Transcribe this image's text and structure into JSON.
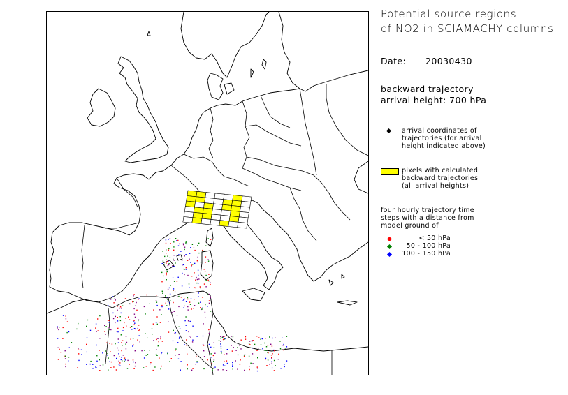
{
  "title_line1": "Potential source regions",
  "title_line2": "of NO2 in SCIAMACHY columns",
  "date_label": "Date:",
  "date_value": "20030430",
  "traj_line1": "backward trajectory",
  "traj_line2": "arrival height: 700 hPa",
  "legend": {
    "arrival": {
      "lines": [
        "arrival coordinates of",
        "trajectories (for arrival",
        "height indicated above)"
      ],
      "color": "#000000",
      "icon": "diamond-marker"
    },
    "pixels": {
      "lines": [
        "pixels with calculated",
        "backward trajectories",
        "(all arrival heights)"
      ],
      "color": "#ffff00",
      "icon": "yellow-rectangle"
    },
    "steps_intro": [
      "four hourly trajectory time",
      "steps with a distance from",
      "model ground of"
    ],
    "steps": [
      {
        "label": "< 50 hPa",
        "color": "#ff0000"
      },
      {
        "label": "50 - 100 hPa",
        "color": "#008000"
      },
      {
        "label": "100 - 150 hPa",
        "color": "#0000ff"
      }
    ]
  }
}
